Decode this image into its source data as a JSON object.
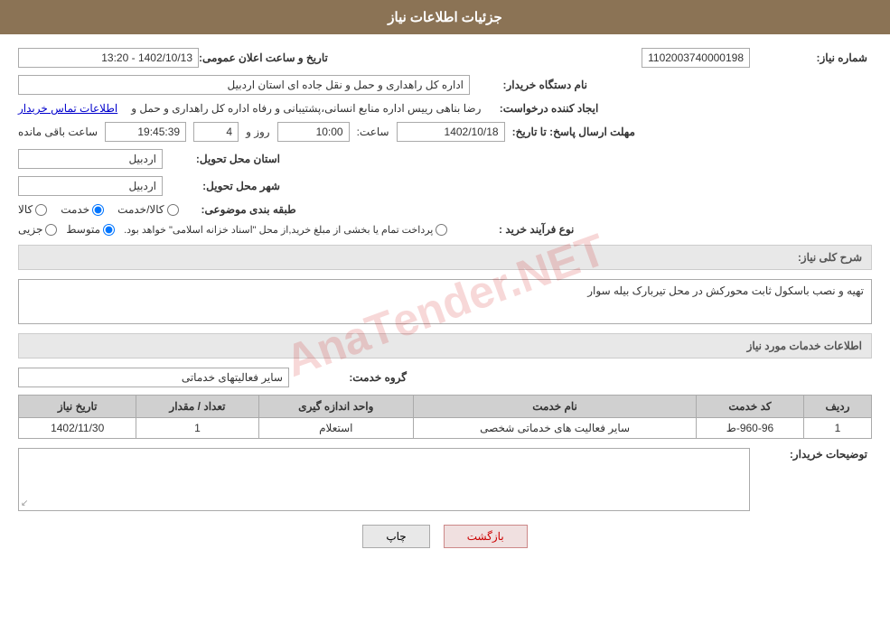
{
  "header": {
    "title": "جزئیات اطلاعات نیاز"
  },
  "fields": {
    "need_number_label": "شماره نیاز:",
    "need_number_value": "1102003740000198",
    "announcement_datetime_label": "تاریخ و ساعت اعلان عمومی:",
    "announcement_datetime_value": "1402/10/13 - 13:20",
    "org_name_label": "نام دستگاه خریدار:",
    "org_name_value": "اداره کل راهداری و حمل و نقل جاده ای استان اردبیل",
    "requester_label": "ایجاد کننده درخواست:",
    "requester_value": "رضا بناهی رییس اداره منابع انسانی،پشتیبانی و رفاه اداره کل راهداری و حمل و",
    "contact_link": "اطلاعات تماس خریدار",
    "deadline_label": "مهلت ارسال پاسخ: تا تاریخ:",
    "deadline_date": "1402/10/18",
    "deadline_time_label": "ساعت:",
    "deadline_time": "10:00",
    "deadline_days_label": "روز و",
    "deadline_days": "4",
    "deadline_remaining_label": "ساعت باقی مانده",
    "deadline_remaining": "19:45:39",
    "province_label": "استان محل تحویل:",
    "province_value": "اردبیل",
    "city_label": "شهر محل تحویل:",
    "city_value": "اردبیل",
    "category_label": "طبقه بندی موضوعی:",
    "category_options": [
      {
        "label": "کالا",
        "value": "kala",
        "checked": false
      },
      {
        "label": "خدمت",
        "value": "khadmat",
        "checked": true
      },
      {
        "label": "کالا/خدمت",
        "value": "kala_khadmat",
        "checked": false
      }
    ],
    "procurement_label": "نوع فرآیند خرید :",
    "procurement_options": [
      {
        "label": "جزیی",
        "checked": false
      },
      {
        "label": "متوسط",
        "checked": true
      },
      {
        "label": "پرداخت تمام یا بخشی از مبلغ خرید,از محل \"اسناد خزانه اسلامی\" خواهد بود.",
        "checked": false
      }
    ],
    "general_description_label": "شرح کلی نیاز:",
    "general_description_value": "تهیه و نصب باسکول ثابت محورکش در محل تیربارک بیله سوار",
    "services_info_label": "اطلاعات خدمات مورد نیاز",
    "service_group_label": "گروه خدمت:",
    "service_group_value": "سایر فعالیتهای خدماتی",
    "table": {
      "headers": [
        "ردیف",
        "کد خدمت",
        "نام خدمت",
        "واحد اندازه گیری",
        "تعداد / مقدار",
        "تاریخ نیاز"
      ],
      "rows": [
        {
          "row_num": "1",
          "service_code": "960-96-ط",
          "service_name": "سایر فعالیت های خدماتی شخصی",
          "unit": "استعلام",
          "quantity": "1",
          "date": "1402/11/30"
        }
      ]
    },
    "buyer_notes_label": "توضیحات خریدار:",
    "buyer_notes_value": ""
  },
  "buttons": {
    "print_label": "چاپ",
    "back_label": "بازگشت"
  }
}
